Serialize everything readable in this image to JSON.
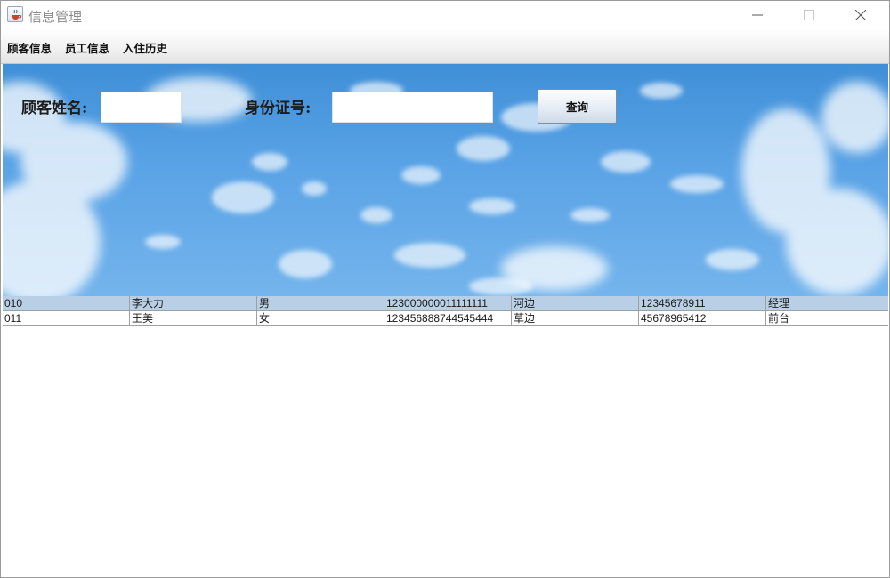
{
  "window": {
    "title": "信息管理"
  },
  "menu": {
    "items": [
      {
        "label": "顾客信息"
      },
      {
        "label": "员工信息"
      },
      {
        "label": "入住历史"
      }
    ]
  },
  "search": {
    "name_label": "顾客姓名:",
    "name_value": "",
    "id_label": "身份证号:",
    "id_value": "",
    "query_button": "查询"
  },
  "table": {
    "rows": [
      {
        "selected": true,
        "cells": [
          "010",
          "李大力",
          "男",
          "123000000011111111",
          "河边",
          "12345678911",
          "经理"
        ]
      },
      {
        "selected": false,
        "cells": [
          "011",
          "王美",
          "女",
          "123456888744545444",
          "草边",
          "45678965412",
          "前台"
        ]
      }
    ]
  },
  "colors": {
    "selected_row": "#b8cfe5",
    "sky": "#4a97dd"
  },
  "icons": {
    "app": "java-coffee-icon",
    "minimize": "minimize-icon",
    "maximize": "maximize-icon",
    "close": "close-icon"
  }
}
